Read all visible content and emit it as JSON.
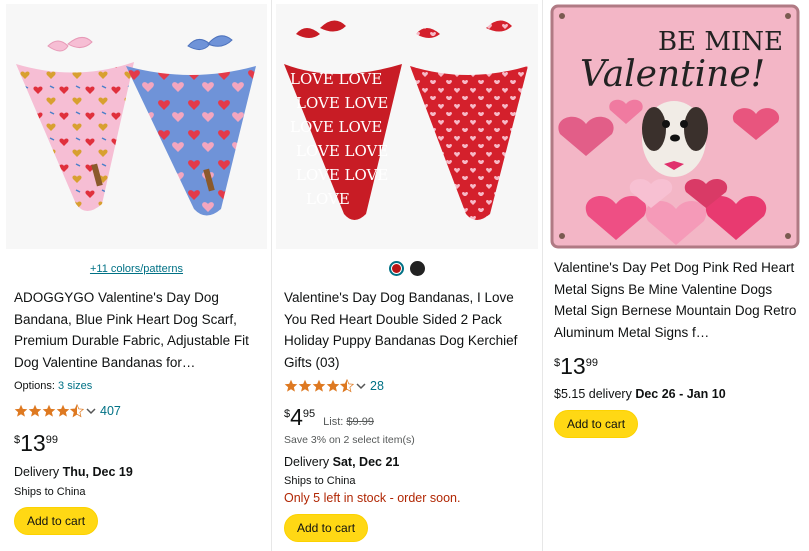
{
  "products": [
    {
      "colors_link": "+11 colors/patterns",
      "title": "ADOGGYGO Valentine's Day Dog Bandana, Blue Pink Heart Dog Scarf, Premium Durable Fabric, Adjustable Fit Dog Valentine Bandanas for…",
      "options_label": "Options:",
      "options_value": "3 sizes",
      "rating": 4.5,
      "rating_count": "407",
      "price_symbol": "$",
      "price_whole": "13",
      "price_fraction": "99",
      "delivery_label": "Delivery",
      "delivery_date": "Thu, Dec 19",
      "ships": "Ships to China",
      "button": "Add to cart"
    },
    {
      "swatches": [
        "red",
        "black"
      ],
      "title": "Valentine's Day Dog Bandanas, I Love You Red Heart Double Sided 2 Pack Holiday Puppy Bandanas Dog Kerchief Gifts (03)",
      "rating": 4.5,
      "rating_count": "28",
      "price_symbol": "$",
      "price_whole": "4",
      "price_fraction": "95",
      "list_label": "List:",
      "list_price": "$9.99",
      "save_text": "Save 3% on 2 select item(s)",
      "delivery_label": "Delivery",
      "delivery_date": "Sat, Dec 21",
      "ships": "Ships to China",
      "stock": "Only 5 left in stock - order soon.",
      "button": "Add to cart"
    },
    {
      "sign_text_1": "BE MINE",
      "sign_text_2": "Valentine!",
      "title": "Valentine's Day Pet Dog Pink Red Heart Metal Signs Be Mine Valentine Dogs Metal Sign Bernese Mountain Dog Retro Aluminum Metal Signs f…",
      "price_symbol": "$",
      "price_whole": "13",
      "price_fraction": "99",
      "delivery_price": "$5.15 delivery",
      "delivery_date": "Dec 26 - Jan 10",
      "button": "Add to cart"
    }
  ],
  "colors": {
    "star": "#de7921",
    "link": "#007185",
    "button": "#ffd814",
    "stock": "#b12704"
  }
}
